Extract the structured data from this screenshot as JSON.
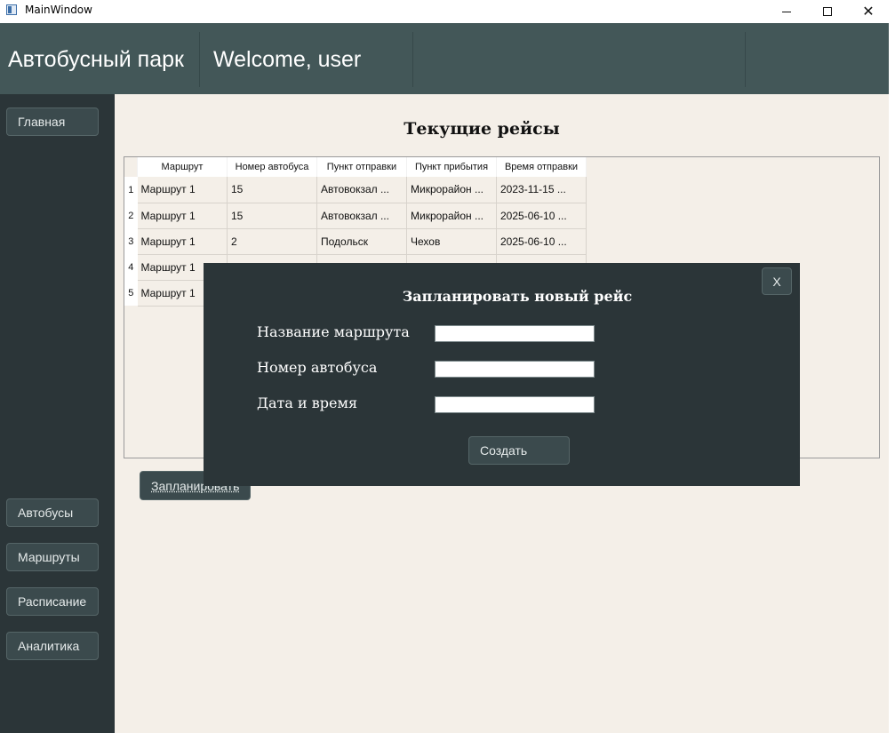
{
  "window": {
    "title": "MainWindow"
  },
  "header": {
    "brand": "Автобусный парк",
    "welcome": "Welcome, user"
  },
  "sidebar": {
    "items": [
      {
        "label": "Главная"
      },
      {
        "label": "Автобусы"
      },
      {
        "label": "Маршруты"
      },
      {
        "label": "Расписание"
      },
      {
        "label": "Аналитика"
      }
    ]
  },
  "main": {
    "title": "Текущие рейсы",
    "table": {
      "columns": [
        "Маршрут",
        "Номер автобуса",
        "Пункт отправки",
        "Пункт прибытия",
        "Время отправки"
      ],
      "rows": [
        {
          "n": "1",
          "cells": [
            "Маршрут 1",
            "15",
            "Автовокзал ...",
            "Микрорайон ...",
            "2023-11-15 ..."
          ]
        },
        {
          "n": "2",
          "cells": [
            "Маршрут 1",
            "15",
            "Автовокзал ...",
            "Микрорайон ...",
            "2025-06-10 ..."
          ]
        },
        {
          "n": "3",
          "cells": [
            "Маршрут 1",
            "2",
            "Подольск",
            "Чехов",
            "2025-06-10 ..."
          ]
        },
        {
          "n": "4",
          "cells": [
            "Маршрут 1",
            "",
            "",
            "",
            ""
          ]
        },
        {
          "n": "5",
          "cells": [
            "Маршрут 1",
            "",
            "",
            "",
            ""
          ]
        }
      ]
    },
    "plan_button": "Запланировать"
  },
  "modal": {
    "title": "Запланировать новый рейс",
    "close_label": "X",
    "fields": [
      {
        "label": "Название маршрута",
        "value": ""
      },
      {
        "label": "Номер автобуса",
        "value": ""
      },
      {
        "label": "Дата и время",
        "value": ""
      }
    ],
    "submit_label": "Создать"
  },
  "colors": {
    "header_bg": "#435758",
    "sidebar_bg": "#2b3538",
    "content_bg": "#f4efe8",
    "button_bg": "#3b4a4d"
  }
}
